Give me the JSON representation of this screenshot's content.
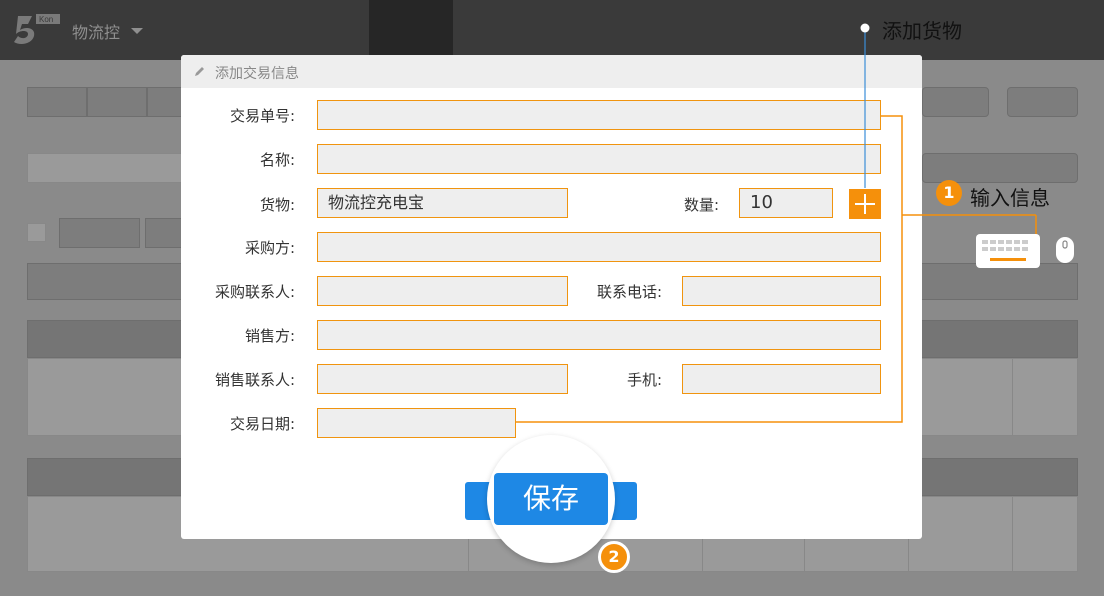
{
  "app": {
    "name": "物流控",
    "logo_text": "Kon"
  },
  "modal": {
    "title": "添加交易信息",
    "fields": {
      "trade_no": {
        "label": "交易单号:",
        "value": ""
      },
      "name": {
        "label": "名称:",
        "value": ""
      },
      "goods": {
        "label": "货物:",
        "value": "物流控充电宝"
      },
      "quantity": {
        "label": "数量:",
        "value": "10"
      },
      "buyer": {
        "label": "采购方:",
        "value": ""
      },
      "buyer_contact": {
        "label": "采购联系人:",
        "value": ""
      },
      "contact_phone": {
        "label": "联系电话:",
        "value": ""
      },
      "seller": {
        "label": "销售方:",
        "value": ""
      },
      "seller_contact": {
        "label": "销售联系人:",
        "value": ""
      },
      "mobile": {
        "label": "手机:",
        "value": ""
      },
      "trade_date": {
        "label": "交易日期:",
        "value": ""
      }
    },
    "save_label": "保存"
  },
  "annotations": {
    "add_goods": "添加货物",
    "input_info": "输入信息",
    "step1": "1",
    "step2": "2"
  },
  "colors": {
    "accent": "#f5900b",
    "primary": "#1e88e5",
    "callout_line": "#3b8ed8"
  },
  "icons": [
    "pencil-icon",
    "plus-icon",
    "keyboard-icon",
    "mouse-icon",
    "caret-down-icon",
    "logo-icon"
  ]
}
